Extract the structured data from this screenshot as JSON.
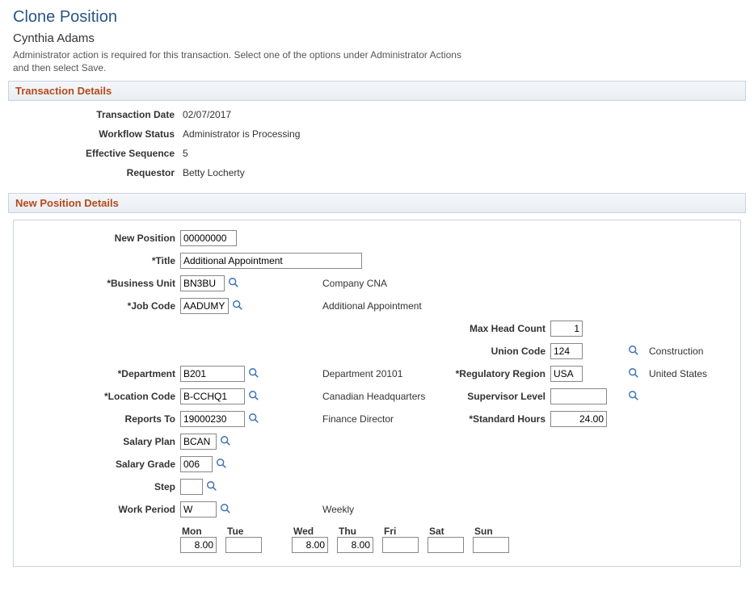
{
  "page": {
    "title": "Clone Position",
    "subtitle": "Cynthia Adams",
    "instruction": "Administrator action is required for this transaction. Select one of the options under Administrator Actions and then select Save."
  },
  "sections": {
    "transaction": "Transaction Details",
    "newPosition": "New Position Details"
  },
  "transaction": {
    "labels": {
      "date": "Transaction Date",
      "workflow": "Workflow Status",
      "effseq": "Effective Sequence",
      "requestor": "Requestor"
    },
    "values": {
      "date": "02/07/2017",
      "workflow": "Administrator is Processing",
      "effseq": "5",
      "requestor": "Betty Locherty"
    }
  },
  "labels": {
    "newPosition": "New Position",
    "title": "*Title",
    "bu": "*Business Unit",
    "jobcode": "*Job Code",
    "company": "Company",
    "dept": "*Department",
    "loc": "*Location Code",
    "reportsTo": "Reports To",
    "salaryPlan": "Salary Plan",
    "salaryGrade": "Salary Grade",
    "step": "Step",
    "workPeriod": "Work Period",
    "maxHead": "Max Head Count",
    "union": "Union Code",
    "regRegion": "*Regulatory Region",
    "supLvl": "Supervisor Level",
    "stdHours": "*Standard Hours"
  },
  "values": {
    "newPosition": "00000000",
    "title": "Additional Appointment",
    "bu": "BN3BU",
    "jobcode": "AADUMY",
    "companyCode": "CNA",
    "jobcodeDesc": "Additional Appointment",
    "dept": "B201",
    "deptDesc": "Department 20101",
    "loc": "B-CCHQ1",
    "locDesc": "Canadian Headquarters",
    "reportsTo": "19000230",
    "reportsToDesc": "Finance Director",
    "salaryPlan": "BCAN",
    "salaryGrade": "006",
    "step": "",
    "workPeriod": "W",
    "workPeriodDesc": "Weekly",
    "maxHead": "1",
    "union": "124",
    "unionDesc": "Construction",
    "regRegion": "USA",
    "regRegionDesc": "United States",
    "supLvl": "",
    "stdHours": "24.00"
  },
  "days": {
    "headers": {
      "mon": "Mon",
      "tue": "Tue",
      "wed": "Wed",
      "thu": "Thu",
      "fri": "Fri",
      "sat": "Sat",
      "sun": "Sun"
    },
    "values": {
      "mon": "8.00",
      "tue": "",
      "wed": "8.00",
      "thu": "8.00",
      "fri": "",
      "sat": "",
      "sun": ""
    }
  }
}
